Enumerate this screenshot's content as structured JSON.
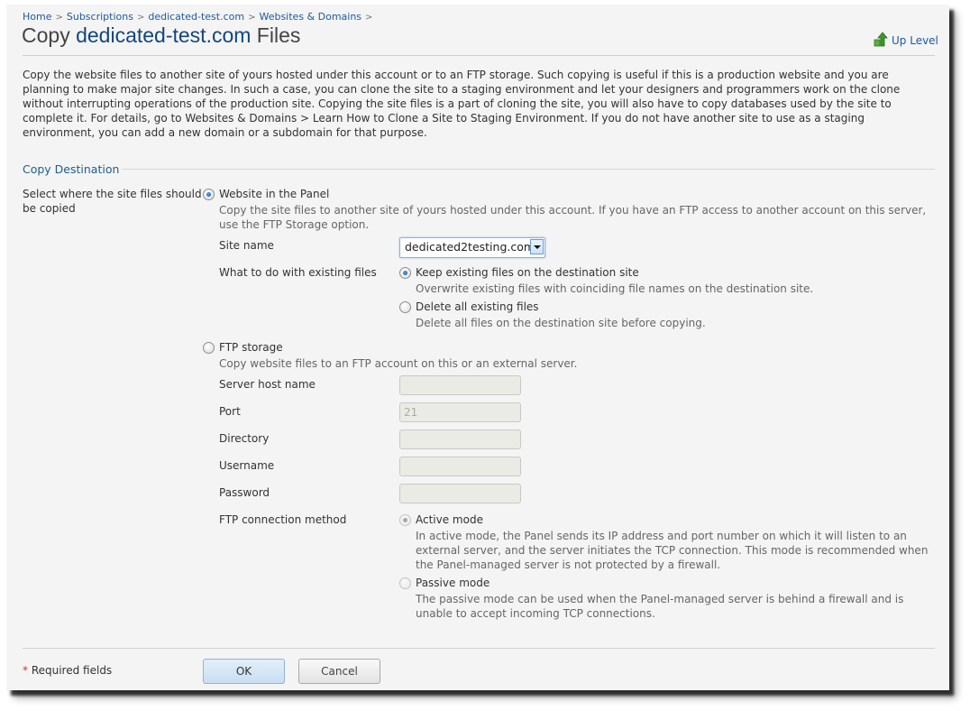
{
  "breadcrumb": [
    "Home",
    "Subscriptions",
    "dedicated-test.com",
    "Websites & Domains"
  ],
  "breadcrumb_separator": ">",
  "title": {
    "prefix": "Copy ",
    "domain": "dedicated-test.com",
    "suffix": " Files"
  },
  "up_level": {
    "label": "Up Level",
    "icon": "up-arrow-icon"
  },
  "intro": "Copy the website files to another site of yours hosted under this account or to an FTP storage. Such copying is useful if this is a production website and you are planning to make major site changes. In such a case, you can clone the site to a staging environment and let your designers and programmers work on the clone without interrupting operations of the production site. Copying the site files is a part of cloning the site, you will also have to copy databases used by the site to complete it. For details, go to Websites & Domains > Learn How to Clone a Site to Staging Environment. If you do not have another site to use as a staging environment, you can add a new domain or a subdomain for that purpose.",
  "section": {
    "title": "Copy Destination"
  },
  "destination": {
    "label": "Select where the site files should be copied",
    "website_option": {
      "label": "Website in the Panel",
      "checked": true,
      "hint": "Copy the site files to another site of yours hosted under this account. If you have an FTP access to another account on this server, use the FTP Storage option."
    },
    "site_name": {
      "label": "Site name",
      "value": "dedicated2testing.com"
    },
    "existing_files": {
      "label": "What to do with existing files",
      "options": [
        {
          "label": "Keep existing files on the destination site",
          "hint": "Overwrite existing files with coinciding file names on the destination site.",
          "checked": true
        },
        {
          "label": "Delete all existing files",
          "hint": "Delete all files on the destination site before copying.",
          "checked": false
        }
      ]
    },
    "ftp_option": {
      "label": "FTP storage",
      "checked": false,
      "hint": "Copy website files to an FTP account on this or an external server."
    },
    "ftp_fields": [
      {
        "label": "Server host name",
        "value": ""
      },
      {
        "label": "Port",
        "value": "21"
      },
      {
        "label": "Directory",
        "value": ""
      },
      {
        "label": "Username",
        "value": ""
      },
      {
        "label": "Password",
        "value": ""
      }
    ],
    "ftp_method": {
      "label": "FTP connection method",
      "options": [
        {
          "label": "Active mode",
          "hint": "In active mode, the Panel sends its IP address and port number on which it will listen to an external server, and the server initiates the TCP connection. This mode is recommended when the Panel-managed server is not protected by a firewall.",
          "checked": true
        },
        {
          "label": "Passive mode",
          "hint": "The passive mode can be used when the Panel-managed server is behind a firewall and is unable to accept incoming TCP connections.",
          "checked": false
        }
      ]
    }
  },
  "footer": {
    "required_star": "*",
    "required_label": " Required fields",
    "ok_label": "OK",
    "cancel_label": "Cancel"
  },
  "colors": {
    "link": "#1e5aa0",
    "title_domain": "#12467e",
    "section": "#1e5e8c",
    "required_star": "#c0392b"
  }
}
